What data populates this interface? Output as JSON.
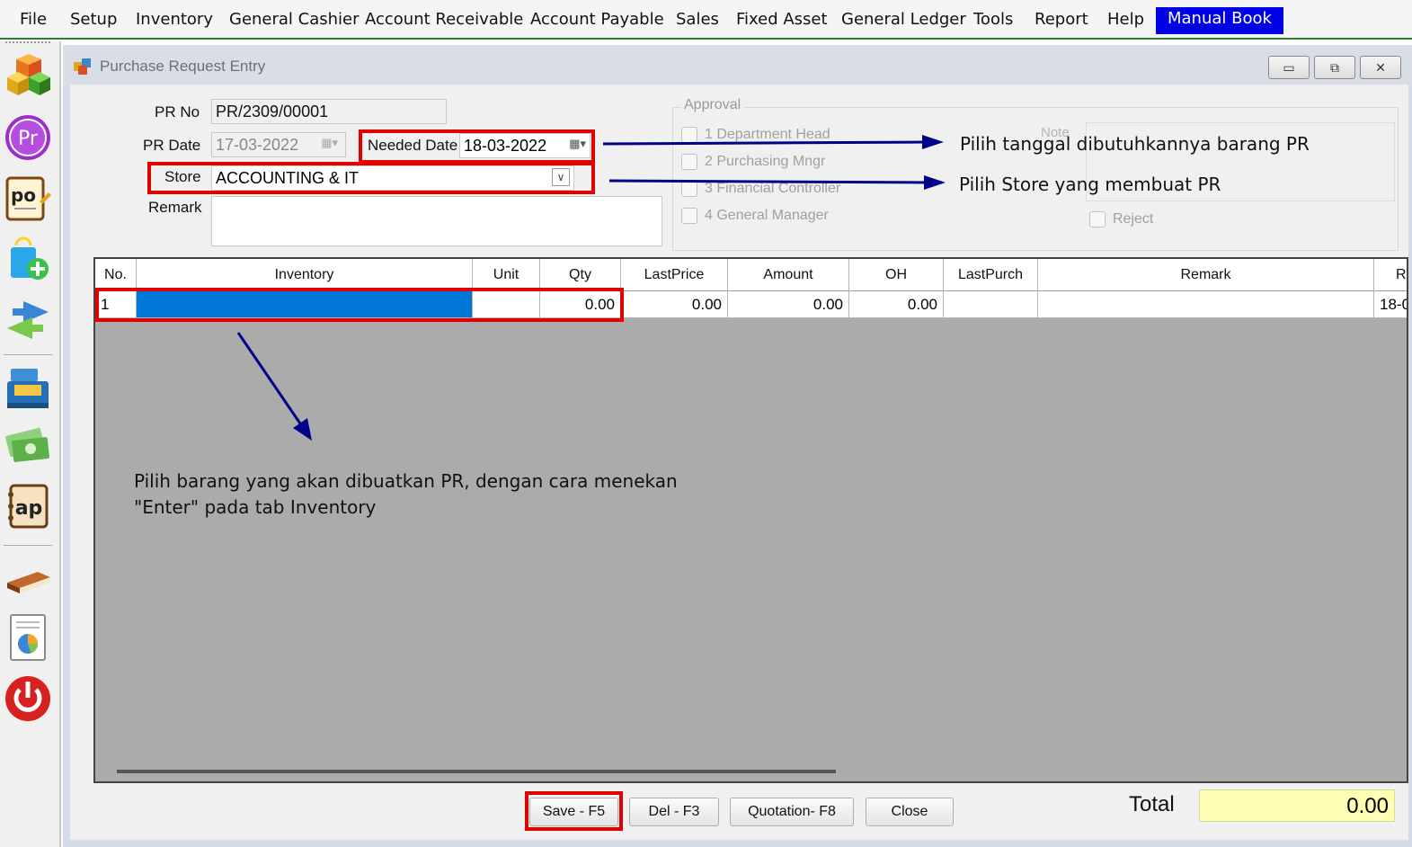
{
  "menu": {
    "items": [
      "File",
      "Setup",
      "Inventory",
      "General Cashier",
      "Account Receivable",
      "Account Payable",
      "Sales",
      "Fixed Asset",
      "General Ledger",
      "Tools",
      "Report",
      "Help"
    ],
    "active_item": "Manual Book"
  },
  "toolbar": {
    "icons": [
      "inventory-cubes-icon",
      "pr-icon",
      "po-icon",
      "shopping-bag-add-icon",
      "transfer-arrows-icon",
      "cash-register-icon",
      "money-icon",
      "ap-icon",
      "book-icon",
      "report-chart-icon",
      "power-icon"
    ]
  },
  "window": {
    "title": "Purchase Request Entry",
    "controls": {
      "minimize": "▭",
      "restore": "⧉",
      "close": "✕"
    }
  },
  "form": {
    "pr_no_label": "PR No",
    "pr_no_value": "PR/2309/00001",
    "pr_date_label": "PR Date",
    "pr_date_value": "17-03-2022",
    "needed_date_label": "Needed Date",
    "needed_date_value": "18-03-2022",
    "store_label": "Store",
    "store_value": "ACCOUNTING & IT",
    "remark_label": "Remark",
    "remark_value": ""
  },
  "approval": {
    "legend": "Approval",
    "items": [
      "1 Department Head",
      "2 Purchasing Mngr",
      "3 Financial Controller",
      "4 General Manager"
    ],
    "note_label": "Note",
    "reject_label": "Reject"
  },
  "annotations": {
    "needed_date_hint": "Pilih tanggal dibutuhkannya barang PR",
    "store_hint": "Pilih Store yang membuat PR",
    "inventory_hint_line1": "Pilih barang yang akan dibuatkan PR, dengan cara menekan",
    "inventory_hint_line2": "\"Enter\" pada tab Inventory"
  },
  "grid": {
    "columns": [
      "No.",
      "Inventory",
      "Unit",
      "Qty",
      "LastPrice",
      "Amount",
      "OH",
      "LastPurch",
      "Remark",
      "R"
    ],
    "rows": [
      {
        "no": "1",
        "inventory": "",
        "unit": "",
        "qty": "0.00",
        "last_price": "0.00",
        "amount": "0.00",
        "oh": "0.00",
        "last_purch": "",
        "remark": "",
        "r": "18-0"
      }
    ]
  },
  "buttons": {
    "save": "Save - F5",
    "delete": "Del - F3",
    "quotation": "Quotation- F8",
    "close": "Close"
  },
  "total": {
    "label": "Total",
    "value": "0.00"
  },
  "colors": {
    "highlight_red": "#e00000",
    "arrow_blue": "#00008b",
    "menu_active": "#0000e6",
    "selected_cell": "#0078d7",
    "total_bg": "#ffffb3"
  }
}
